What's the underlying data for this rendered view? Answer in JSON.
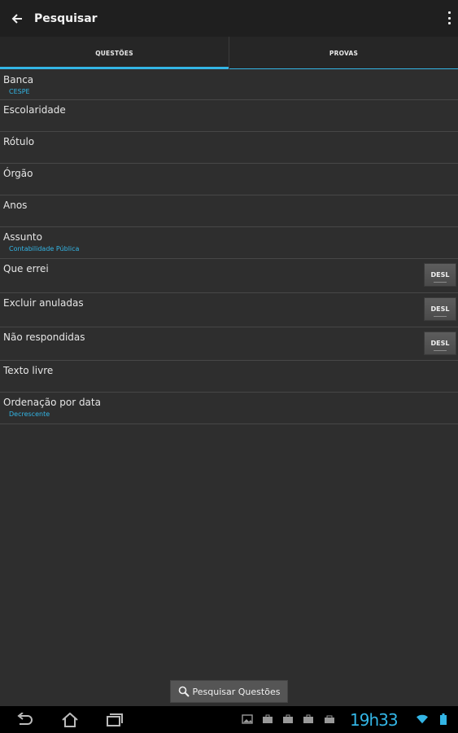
{
  "header": {
    "title": "Pesquisar"
  },
  "tabs": [
    {
      "label": "QUESTÕES",
      "active": true
    },
    {
      "label": "PROVAS",
      "active": false
    }
  ],
  "filters": [
    {
      "label": "Banca",
      "value": "CESPE"
    },
    {
      "label": "Escolaridade",
      "value": ""
    },
    {
      "label": "Rótulo",
      "value": ""
    },
    {
      "label": "Órgão",
      "value": ""
    },
    {
      "label": "Anos",
      "value": ""
    },
    {
      "label": "Assunto",
      "value": "Contabilidade Pública"
    },
    {
      "label": "Que errei",
      "toggle": "DESL"
    },
    {
      "label": "Excluir anuladas",
      "toggle": "DESL"
    },
    {
      "label": "Não respondidas",
      "toggle": "DESL"
    },
    {
      "label": "Texto livre",
      "value": ""
    },
    {
      "label": "Ordenação por data",
      "value": "Decrescente"
    }
  ],
  "search_button": {
    "label": "Pesquisar Questões",
    "icon": "search-icon"
  },
  "status_bar": {
    "clock": "19h33",
    "notification_icons": [
      "image-icon",
      "briefcase-icon",
      "briefcase-icon",
      "briefcase-icon",
      "store-icon"
    ],
    "status_icons": [
      "wifi-icon",
      "battery-icon"
    ]
  },
  "colors": {
    "accent": "#33b5e5",
    "background": "#2e2e2e",
    "action_bar": "#1f1f1f"
  }
}
